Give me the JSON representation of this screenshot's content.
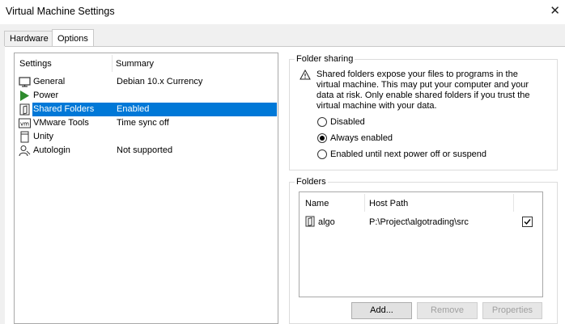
{
  "window": {
    "title": "Virtual Machine Settings"
  },
  "tabs": [
    {
      "label": "Hardware",
      "selected": false
    },
    {
      "label": "Options",
      "selected": true
    }
  ],
  "settings_list": {
    "headers": {
      "settings": "Settings",
      "summary": "Summary"
    },
    "rows": [
      {
        "label": "General",
        "summary": "Debian 10.x Currency",
        "icon": "monitor-icon",
        "selected": false
      },
      {
        "label": "Power",
        "summary": "",
        "icon": "play-icon",
        "selected": false
      },
      {
        "label": "Shared Folders",
        "summary": "Enabled",
        "icon": "folder-share-icon",
        "selected": true
      },
      {
        "label": "VMware Tools",
        "summary": "Time sync off",
        "icon": "vm-icon",
        "selected": false
      },
      {
        "label": "Unity",
        "summary": "",
        "icon": "window-icon",
        "selected": false
      },
      {
        "label": "Autologin",
        "summary": "Not supported",
        "icon": "user-key-icon",
        "selected": false
      }
    ]
  },
  "folder_sharing": {
    "title": "Folder sharing",
    "warning": "Shared folders expose your files to programs in the virtual machine. This may put your computer and your data at risk. Only enable shared folders if you trust the virtual machine with your data.",
    "options": [
      {
        "label": "Disabled",
        "checked": false
      },
      {
        "label": "Always enabled",
        "checked": true
      },
      {
        "label": "Enabled until next power off or suspend",
        "checked": false
      }
    ]
  },
  "folders": {
    "title": "Folders",
    "headers": {
      "name": "Name",
      "host_path": "Host Path"
    },
    "rows": [
      {
        "name": "algo",
        "host_path": "P:\\Project\\algotrading\\src",
        "enabled": true
      }
    ],
    "buttons": {
      "add": "Add...",
      "remove": "Remove",
      "properties": "Properties"
    }
  },
  "colors": {
    "selection": "#0078d7",
    "power_green": "#2e8b2e"
  }
}
